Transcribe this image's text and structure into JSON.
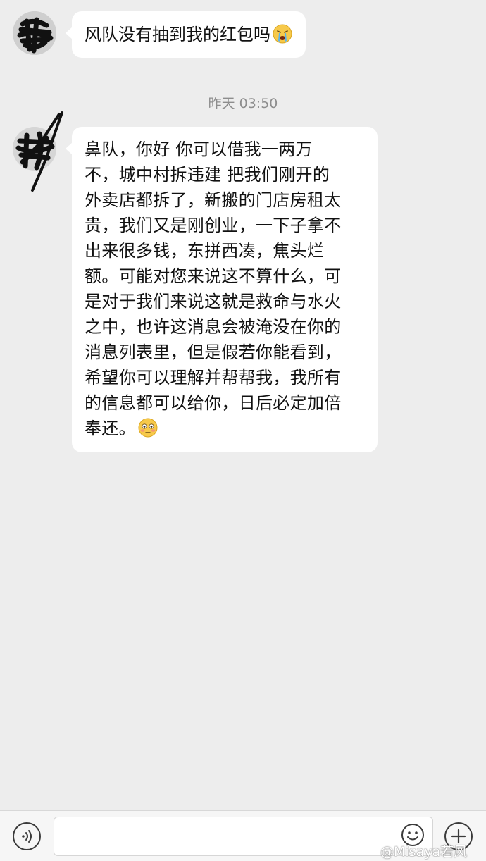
{
  "messages": [
    {
      "text": "风队没有抽到我的红包吗",
      "emoji": "crying-face-emoji"
    },
    {
      "lines": [
        "鼻队，你好 你可以借我一两万",
        "不，城中村拆违建 把我们刚开的",
        "外卖店都拆了，新搬的门店房租太",
        "贵，我们又是刚创业，一下子拿不",
        "出来很多钱，东拼西凑，焦头烂",
        "额。可能对您来说这不算什么，可",
        "是对于我们来说这就是救命与水火",
        "之中，也许这消息会被淹没在你的",
        "消息列表里，但是假若你能看到，",
        "希望你可以理解并帮帮我，我所有",
        "的信息都可以给你，日后必定加倍",
        "奉还。"
      ],
      "emoji": "flushed-face-emoji"
    }
  ],
  "timestamp": "昨天 03:50",
  "input_bar": {
    "voice_icon": "voice-icon",
    "emoji_icon": "smiley-icon",
    "plus_icon": "plus-icon"
  },
  "watermark": "@Misaya若风",
  "colors": {
    "background": "#ededed",
    "bubble": "#ffffff",
    "timestamp": "#8d8d8d"
  }
}
